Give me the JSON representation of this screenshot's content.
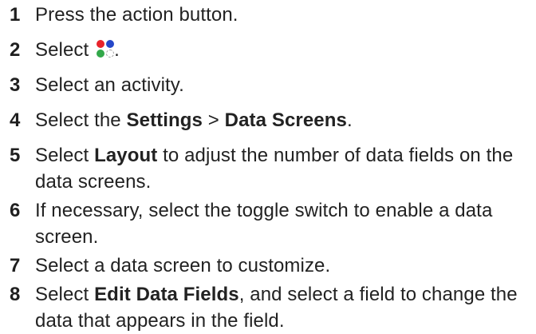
{
  "steps": [
    {
      "num": "1",
      "text": "Press the action button."
    },
    {
      "num": "2",
      "text_before": "Select",
      "icon": "apps-dots-icon",
      "text_after": "."
    },
    {
      "num": "3",
      "text": "Select an activity."
    },
    {
      "num": "4",
      "text_before": "Select the ",
      "bold_1": "Settings",
      "sep": " > ",
      "bold_2": "Data Screens",
      "text_after": "."
    },
    {
      "num": "5",
      "text_before": "Select ",
      "bold_1": "Layout",
      "text_after": " to adjust the number of data fields on the data screens."
    },
    {
      "num": "6",
      "text": "If necessary, select the toggle switch to enable a data screen."
    },
    {
      "num": "7",
      "text": "Select a data screen to customize."
    },
    {
      "num": "8",
      "text_before": "Select ",
      "bold_1": "Edit Data Fields",
      "text_after": ", and select a field to change the data that appears in the field."
    }
  ],
  "colors": {
    "text": "#222222",
    "icon_red": "#e8232b",
    "icon_blue": "#2547c9",
    "icon_green": "#33a84a"
  }
}
